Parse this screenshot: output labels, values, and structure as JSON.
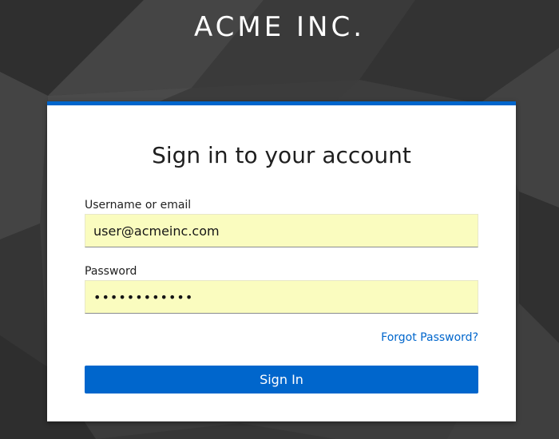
{
  "brand": {
    "name": "ACME INC."
  },
  "login": {
    "title": "Sign in to your account",
    "username_label": "Username or email",
    "username_value": "user@acmeinc.com",
    "password_label": "Password",
    "password_value": "passwordpass",
    "forgot_link": "Forgot Password?",
    "submit_label": "Sign In"
  },
  "colors": {
    "accent": "#0066cc",
    "autofill": "#fafcbf",
    "background": "#3a3a3a",
    "card": "#ffffff"
  }
}
